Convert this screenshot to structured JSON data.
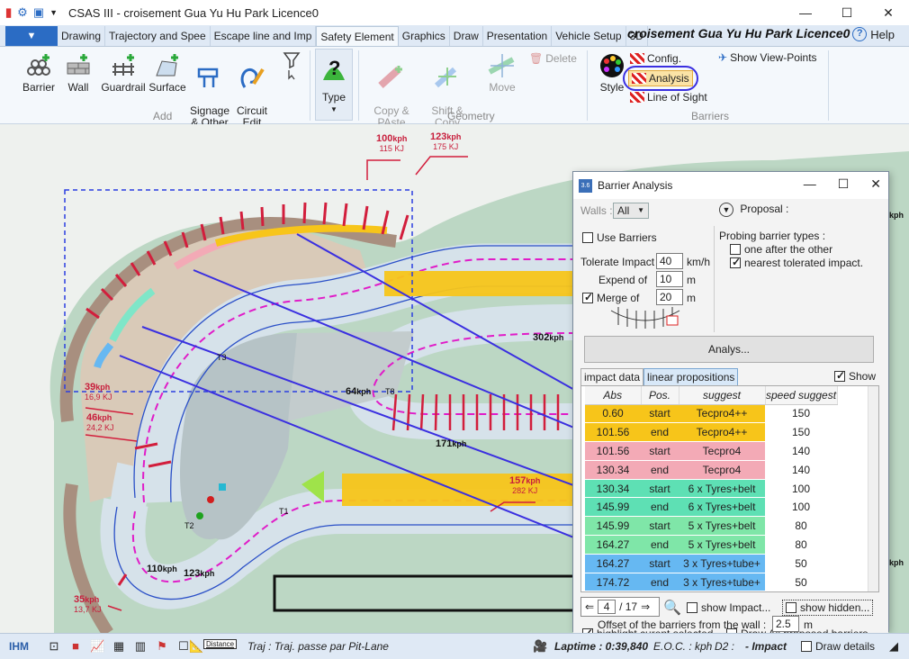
{
  "app": {
    "title": "CSAS III - croisement Gua Yu Hu Park Licence0",
    "doc_title": "croisement Gua Yu Hu Park Licence0",
    "help": "Help"
  },
  "tabs": [
    "Drawing",
    "Trajectory and Spee",
    "Escape line and Imp",
    "Safety Element",
    "Graphics",
    "Draw",
    "Presentation",
    "Vehicle Setup",
    "3D"
  ],
  "ribbon": {
    "add": {
      "label": "Add",
      "barrier": "Barrier",
      "wall": "Wall",
      "guardrail": "Guardrail",
      "surface": "Surface",
      "signage": "Signage\n& Other",
      "circuit": "Circuit\nEdit"
    },
    "type": {
      "label": "Type"
    },
    "geometry": {
      "label": "Geometry",
      "copy": "Copy &\nPAste",
      "shift": "Shift &\nCopy",
      "move": "Move",
      "delete": "Delete"
    },
    "barriers": {
      "label": "Barriers",
      "style": "Style",
      "config": "Config.",
      "analysis": "Analysis",
      "line_of_sight": "Line of Sight",
      "show_view_points": "Show View-Points"
    }
  },
  "map": {
    "labels": {
      "s100": "100",
      "s100_unit": "kph",
      "s100_kj": "115 KJ",
      "s123a": "123",
      "s123a_unit": "kph",
      "s123a_kj": "175 KJ",
      "s39": "39",
      "s39_unit": "kph",
      "s39_kj": "16,9 KJ",
      "s46": "46",
      "s46_unit": "kph",
      "s46_kj": "24,2 KJ",
      "s157": "157",
      "s157_unit": "kph",
      "s157_kj": "282 KJ",
      "s35": "35",
      "s35_unit": "kph",
      "s35_kj": "13,7 KJ",
      "s302": "302",
      "s302_unit": "kph",
      "s64": "64",
      "s64_unit": "kph",
      "s171": "171",
      "s171_unit": "kph",
      "s110": "110",
      "s110_unit": "kph",
      "s123b": "123",
      "s123b_unit": "kph",
      "t1": "T1",
      "t2": "T2",
      "t3": "T3",
      "t8": "T8",
      "edge_kph1": "kph",
      "edge_kph2": "kph"
    }
  },
  "dialog": {
    "title": "Barrier Analysis",
    "icon_text": "3.6",
    "walls_label": "Walls :",
    "walls_value": "All",
    "use_barriers": "Use Barriers",
    "tolerate_impact": "Tolerate Impact",
    "tolerate_value": "40",
    "tolerate_unit": "km/h",
    "expend_of": "Expend of",
    "expend_value": "10",
    "expend_unit": "m",
    "merge_of": "Merge of",
    "merge_value": "20",
    "merge_unit": "m",
    "proposal": "Proposal :",
    "probing_label": "Probing barrier types :",
    "probe_one": "one after the other",
    "probe_nearest": "nearest tolerated impact.",
    "analys_button": "Analys...",
    "tab_impact": "impact data",
    "tab_linear": "linear propositions",
    "show": "Show",
    "columns": [
      "Abs",
      "Pos.",
      "suggest",
      "speed suggest"
    ],
    "rows": [
      {
        "abs": "0.60",
        "pos": "start",
        "suggest": "Tecpro4++",
        "speed": "150",
        "color": "#f7c51a"
      },
      {
        "abs": "101.56",
        "pos": "end",
        "suggest": "Tecpro4++",
        "speed": "150",
        "color": "#f7c51a"
      },
      {
        "abs": "101.56",
        "pos": "start",
        "suggest": "Tecpro4",
        "speed": "140",
        "color": "#f3aab6"
      },
      {
        "abs": "130.34",
        "pos": "end",
        "suggest": "Tecpro4",
        "speed": "140",
        "color": "#f3aab6"
      },
      {
        "abs": "130.34",
        "pos": "start",
        "suggest": "6 x Tyres+belt",
        "speed": "100",
        "color": "#5ee0b4"
      },
      {
        "abs": "145.99",
        "pos": "end",
        "suggest": "6 x Tyres+belt",
        "speed": "100",
        "color": "#5ee0b4"
      },
      {
        "abs": "145.99",
        "pos": "start",
        "suggest": "5 x Tyres+belt",
        "speed": "80",
        "color": "#7fe6a8"
      },
      {
        "abs": "164.27",
        "pos": "end",
        "suggest": "5 x Tyres+belt",
        "speed": "80",
        "color": "#7fe6a8"
      },
      {
        "abs": "164.27",
        "pos": "start",
        "suggest": "3 x Tyres+tube+",
        "speed": "50",
        "color": "#66b8f2"
      },
      {
        "abs": "174.72",
        "pos": "end",
        "suggest": "3 x Tyres+tube+",
        "speed": "50",
        "color": "#66b8f2"
      }
    ],
    "page_current": "4",
    "page_total": "/ 17",
    "show_impact": "show Impact...",
    "show_hidden": "show hidden...",
    "highlight": "highlight curent selected",
    "draw_all": "Draw All proposed barriers",
    "offset_label": "Offset of the barriers from the wall :",
    "offset_value": "2.5",
    "offset_unit": "m"
  },
  "status": {
    "ihm": "IHM",
    "distance_icon": "Distance",
    "traj_label": "Traj :",
    "traj_value": "Traj. passe par Pit-Lane",
    "laptime": "Laptime : 0:39,840",
    "eoc": "E.O.C. : kph",
    "d2": "D2 :",
    "impact": "- Impact",
    "draw_details": "Draw details"
  }
}
